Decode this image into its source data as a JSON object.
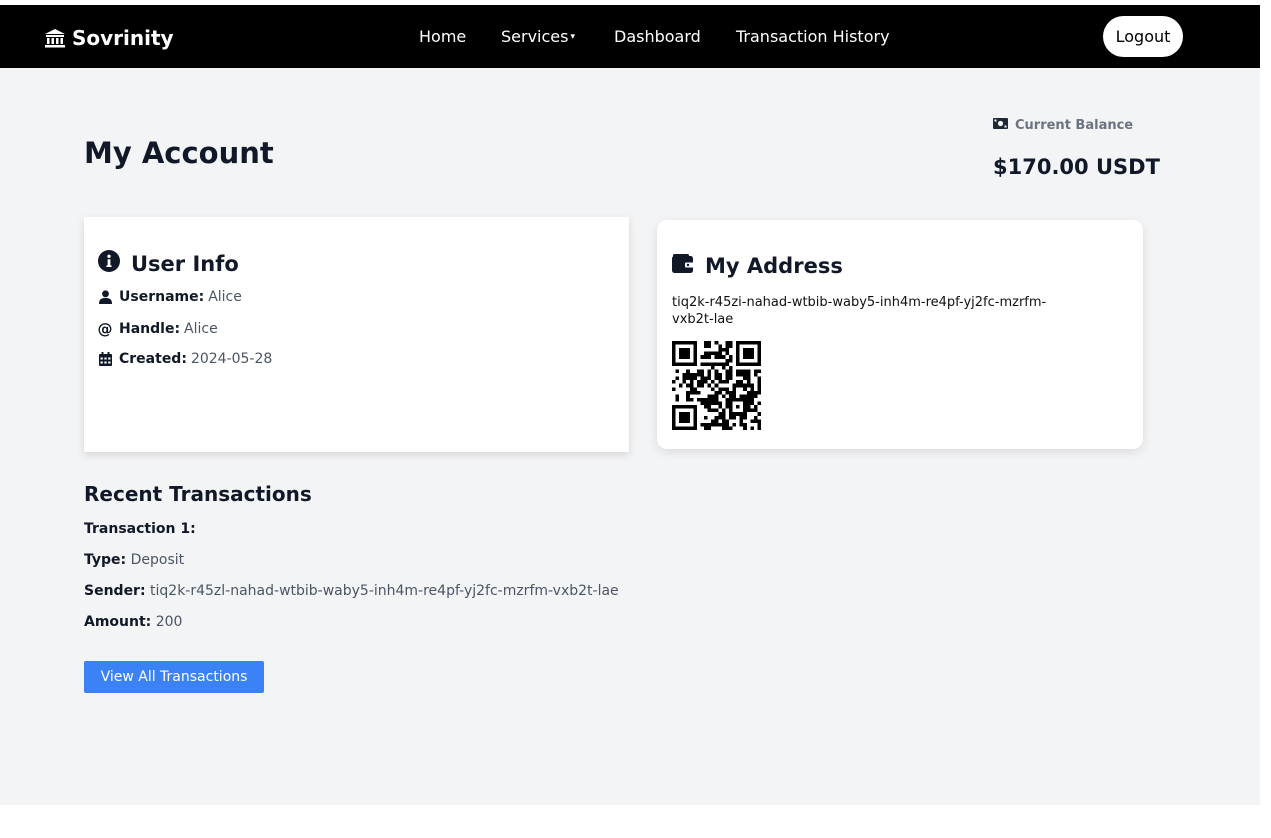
{
  "nav": {
    "brand": "Sovrinity",
    "links": {
      "home": "Home",
      "services": "Services",
      "dashboard": "Dashboard",
      "history": "Transaction History"
    },
    "logout": "Logout"
  },
  "page": {
    "title": "My Account"
  },
  "balance": {
    "label": "Current Balance",
    "value": "$170.00 USDT"
  },
  "user_info": {
    "title": "User Info",
    "username_label": "Username:",
    "username": "Alice",
    "handle_label": "Handle:",
    "handle": "Alice",
    "created_label": "Created:",
    "created": "2024-05-28"
  },
  "address": {
    "title": "My Address",
    "value": "tiq2k-r45zi-nahad-wtbib-waby5-inh4m-re4pf-yj2fc-mzrfm-vxb2t-lae"
  },
  "transactions": {
    "title": "Recent Transactions",
    "items": [
      {
        "heading": "Transaction 1:",
        "type_label": "Type:",
        "type": "Deposit",
        "sender_label": "Sender:",
        "sender": "tiq2k-r45zl-nahad-wtbib-waby5-inh4m-re4pf-yj2fc-mzrfm-vxb2t-lae",
        "amount_label": "Amount:",
        "amount": "200"
      }
    ],
    "view_all": "View All Transactions"
  },
  "icons": {
    "brand": "bank-icon",
    "balance": "money-icon",
    "user_info": "info-circle-icon",
    "username": "user-icon",
    "handle": "at-icon",
    "created": "calendar-icon",
    "address": "wallet-icon"
  },
  "colors": {
    "navbar": "#000000",
    "primary_button": "#3b82f6",
    "page_background": "#f3f4f6"
  }
}
